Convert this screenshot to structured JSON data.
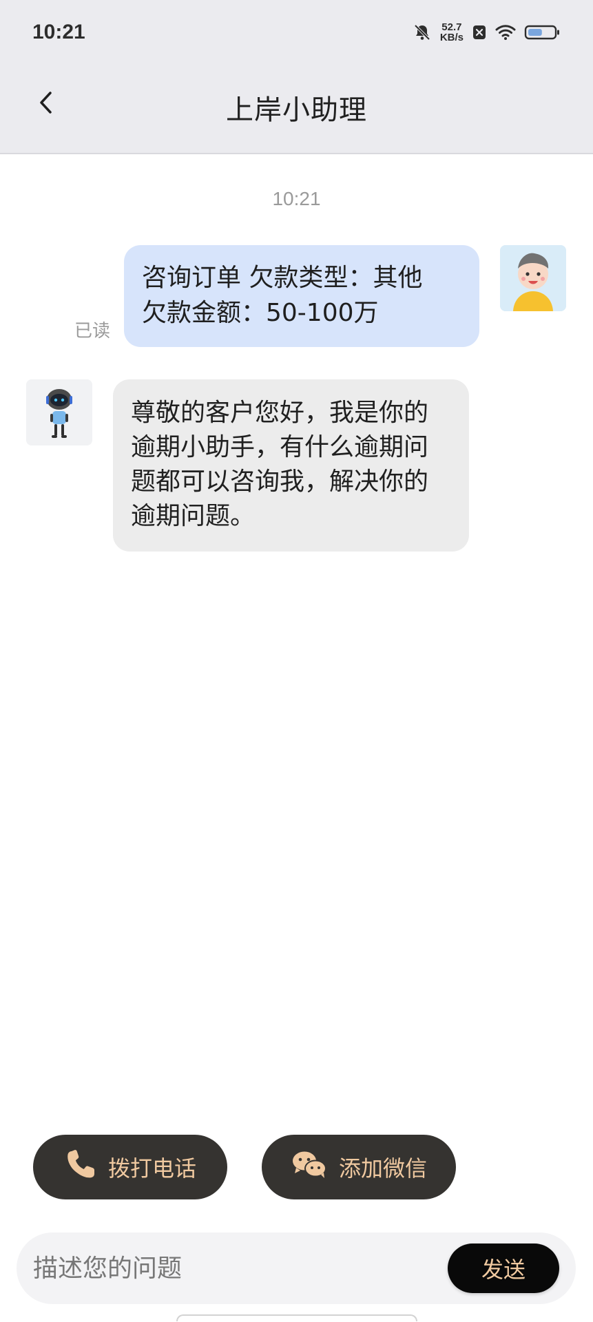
{
  "status_bar": {
    "time": "10:21",
    "network_speed_value": "52.7",
    "network_speed_unit": "KB/s",
    "icons": [
      "bell-muted-icon",
      "network-speed",
      "sim-blocked-icon",
      "wifi-icon",
      "battery-icon"
    ],
    "battery_level": 0.55
  },
  "header": {
    "title": "上岸小助理",
    "back_icon": "chevron-left-icon"
  },
  "chat": {
    "timestamp": "10:21",
    "messages": [
      {
        "sender": "user",
        "avatar_icon": "user-avatar-icon",
        "lines": [
          "咨询订单  欠款类型：其他",
          "欠款金额：50-100万"
        ],
        "read_status": "已读"
      },
      {
        "sender": "assistant",
        "avatar_icon": "robot-avatar-icon",
        "lines": [
          "尊敬的客户您好，我是你的",
          "逾期小助手，有什么逾期问",
          "题都可以咨询我，解决你的",
          "逾期问题。"
        ]
      }
    ]
  },
  "actions": {
    "call_label": "拨打电话",
    "call_icon": "phone-icon",
    "wechat_label": "添加微信",
    "wechat_icon": "wechat-icon"
  },
  "composer": {
    "placeholder": "描述您的问题",
    "value": "",
    "send_label": "发送"
  },
  "colors": {
    "header_bg": "#ebebef",
    "user_bubble": "#d7e4fb",
    "bot_bubble": "#ececec",
    "action_button_bg": "#353330",
    "accent_text": "#f0c9a0",
    "send_button_bg": "#090909"
  }
}
